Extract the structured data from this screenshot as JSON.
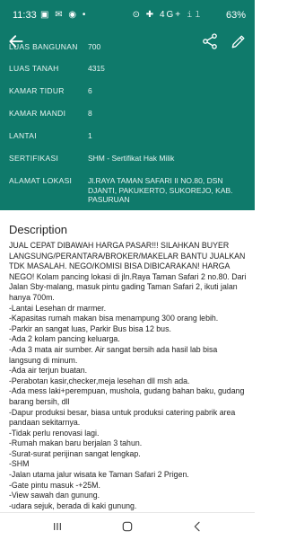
{
  "status_bar": {
    "time": "11:33",
    "left_icons": "▣ ✉ ◉ •",
    "right_icons": "⊙ ✚ 4G+ 𝚒𝚕",
    "battery": "63%"
  },
  "detail_rows": [
    {
      "label": "LUAS BANGUNAN",
      "value": "700"
    },
    {
      "label": "LUAS TANAH",
      "value": "4315"
    },
    {
      "label": "KAMAR TIDUR",
      "value": "6"
    },
    {
      "label": "KAMAR MANDI",
      "value": "8"
    },
    {
      "label": "LANTAI",
      "value": "1"
    },
    {
      "label": "SERTIFIKASI",
      "value": "SHM - Sertifikat Hak Milik"
    },
    {
      "label": "ALAMAT LOKASI",
      "value": "Jl.RAYA TAMAN SAFARI II NO.80, DSN DJANTI, PAKUKERTO, SUKOREJO, KAB. PASURUAN"
    }
  ],
  "description": {
    "title": "Description",
    "body": "JUAL CEPAT DIBAWAH HARGA PASAR!!! SILAHKAN BUYER LANGSUNG/PERANTARA/BROKER/MAKELAR BANTU JUALKAN TDK MASALAH. NEGO/KOMISI BISA DIBICARAKAN! HARGA NEGO! Kolam pancing lokasi di jln.Raya Taman Safari 2 no.80. Dari Jalan Sby-malang, masuk pintu gading Taman Safari 2, ikuti jalan hanya 700m.\n-Lantai Lesehan dr marmer.\n-Kapasitas rumah makan bisa menampung 300 orang lebih.\n-Parkir an sangat luas, Parkir Bus bisa 12 bus.\n-Ada 2 kolam pancing keluarga.\n-Ada 3 mata air sumber. Air sangat bersih ada hasil lab bisa langsung di minum.\n-Ada air terjun buatan.\n-Perabotan kasir,checker,meja lesehan dll msh ada.\n-Ada mess laki+perempuan, mushola, gudang bahan baku, gudang barang bersih, dll\n-Dapur produksi besar, biasa untuk produksi catering pabrik area pandaan sekitarnya.\n-Tidak perlu renovasi lagi.\n-Rumah makan baru berjalan 3 tahun.\n-Surat-surat perijinan sangat lengkap.\n-SHM\n-Jalan utama jalur wisata ke Taman Safari 2 Prigen.\n-Gate pintu masuk -+25M.\n-View sawah dan gunung.\n-udara sejuk, berada di kaki gunung."
  },
  "colors": {
    "primary": "#0f7a6b",
    "detail_text": "#e9f4f2"
  },
  "icons": {
    "back": "back-arrow-icon",
    "share": "share-icon",
    "edit": "edit-pencil-icon",
    "recents": "recents-icon",
    "home": "home-icon",
    "nav_back": "nav-back-icon"
  }
}
